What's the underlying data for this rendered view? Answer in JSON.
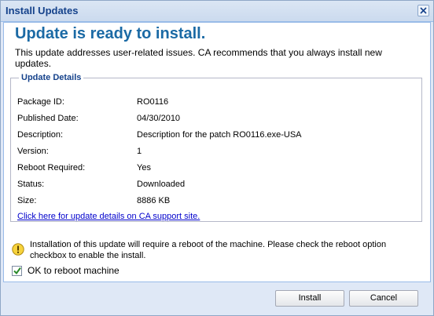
{
  "window": {
    "title": "Install Updates"
  },
  "heading": "Update is ready to install.",
  "intro": "This update addresses user-related issues. CA recommends that you always install new updates.",
  "details": {
    "legend": "Update Details",
    "rows": [
      {
        "label": "Package ID:",
        "value": "RO0116"
      },
      {
        "label": "Published Date:",
        "value": "04/30/2010"
      },
      {
        "label": "Description:",
        "value": "Description for the patch RO0116.exe-USA"
      },
      {
        "label": "Version:",
        "value": "1"
      },
      {
        "label": "Reboot Required:",
        "value": "Yes"
      },
      {
        "label": "Status:",
        "value": "Downloaded"
      },
      {
        "label": "Size:",
        "value": "8886 KB"
      }
    ],
    "link": "Click here for update details on CA support site."
  },
  "warning": {
    "icon": "warning-icon",
    "text": "Installation of this update will require a reboot of the machine. Please check the reboot option checkbox to enable the install."
  },
  "reboot_checkbox": {
    "label": "OK to reboot machine",
    "checked": true
  },
  "buttons": {
    "install": "Install",
    "cancel": "Cancel"
  },
  "colors": {
    "heading": "#1b6aa5",
    "title": "#15428b",
    "link": "#0000cc"
  }
}
